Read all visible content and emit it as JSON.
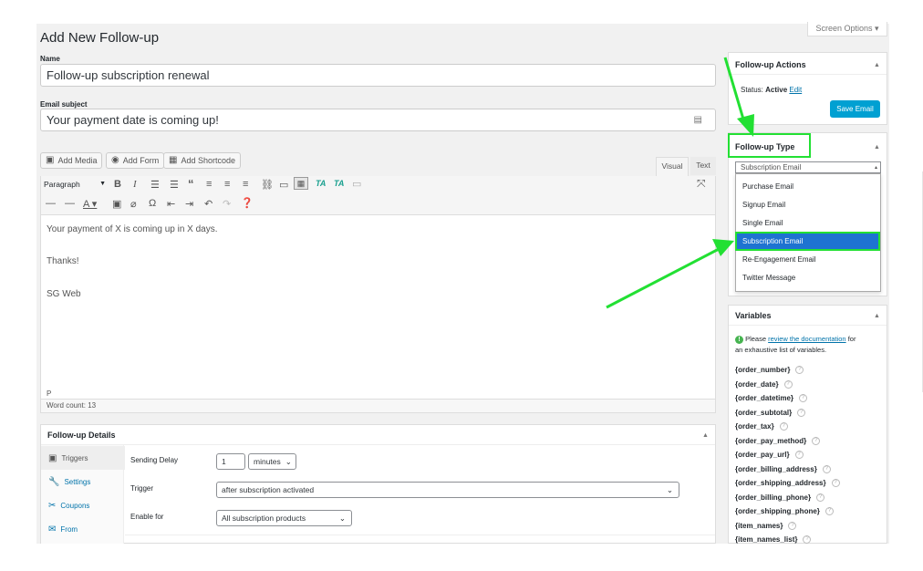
{
  "screen_options": "Screen Options",
  "page_title": "Add New Follow-up",
  "name": {
    "label": "Name",
    "value": "Follow-up subscription renewal"
  },
  "email_subject": {
    "label": "Email subject",
    "value": "Your payment date is coming up!"
  },
  "media_buttons": {
    "add_media": "Add Media",
    "add_form": "Add Form",
    "add_shortcode": "Add Shortcode"
  },
  "editor_tabs": {
    "visual": "Visual",
    "text": "Text"
  },
  "format_select": "Paragraph",
  "editor_content": {
    "line1": "Your payment of X is coming up in X days.",
    "line2": "Thanks!",
    "line3": "SG Web"
  },
  "status_path": "P",
  "word_count": "Word count: 13",
  "followup_details": {
    "title": "Follow-up Details",
    "tabs": [
      "Triggers",
      "Settings",
      "Coupons",
      "From"
    ],
    "sending_delay": {
      "label": "Sending Delay",
      "value": "1",
      "unit": "minutes"
    },
    "trigger": {
      "label": "Trigger",
      "value": "after subscription activated"
    },
    "enable_for": {
      "label": "Enable for",
      "value": "All subscription products"
    }
  },
  "followup_actions": {
    "title": "Follow-up Actions",
    "status_label": "Status:",
    "status_value": "Active",
    "edit_link": "Edit",
    "save_button": "Save Email"
  },
  "followup_type": {
    "title": "Follow-up Type",
    "selected": "Subscription Email",
    "options": [
      "Purchase Email",
      "Signup Email",
      "Single Email",
      "Subscription Email",
      "Re-Engagement Email",
      "Twitter Message"
    ]
  },
  "variables": {
    "title": "Variables",
    "note_before": "Please",
    "note_link": "review the documentation",
    "note_after": "for",
    "note_line2": "an exhaustive list of variables.",
    "items": [
      "{order_number}",
      "{order_date}",
      "{order_datetime}",
      "{order_subtotal}",
      "{order_tax}",
      "{order_pay_method}",
      "{order_pay_url}",
      "{order_billing_address}",
      "{order_shipping_address}",
      "{order_billing_phone}",
      "{order_shipping_phone}",
      "{item_names}",
      "{item_names_list}"
    ]
  },
  "colors": {
    "accent_green": "#22e033",
    "wp_blue": "#0073aa",
    "highlight": "#1e73d1",
    "primary_button": "#00a0d2"
  }
}
